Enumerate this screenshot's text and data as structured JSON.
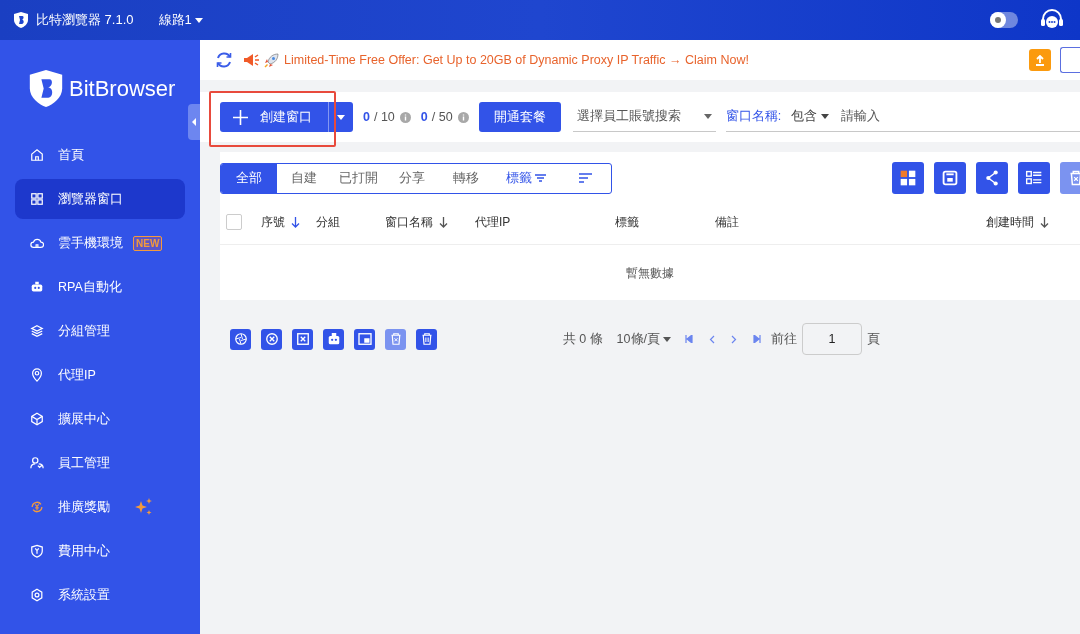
{
  "title_bar": {
    "app_title": "比特瀏覽器 7.1.0",
    "route": "線路1",
    "dark_mode": {
      "on": false
    }
  },
  "sidebar": {
    "logo_text": "BitBrowser",
    "items": [
      {
        "label": "首頁",
        "selected": false,
        "kind": "plain"
      },
      {
        "label": "瀏覽器窗口",
        "selected": true,
        "kind": "plain"
      },
      {
        "label": "雲手機環境",
        "selected": false,
        "kind": "badge",
        "badge": "NEW"
      },
      {
        "label": "RPA自動化",
        "selected": false,
        "kind": "plain"
      },
      {
        "label": "分組管理",
        "selected": false,
        "kind": "plain"
      },
      {
        "label": "代理IP",
        "selected": false,
        "kind": "plain"
      },
      {
        "label": "擴展中心",
        "selected": false,
        "kind": "plain"
      },
      {
        "label": "員工管理",
        "selected": false,
        "kind": "plain"
      },
      {
        "label": "推廣獎勵",
        "selected": false,
        "kind": "sparkle"
      },
      {
        "label": "費用中心",
        "selected": false,
        "kind": "plain"
      },
      {
        "label": "系統設置",
        "selected": false,
        "kind": "plain"
      }
    ]
  },
  "banner": {
    "text": "Limited-Time Free Offer: Get Up to 20GB of Dynamic Proxy IP Traffic → Claim Now!"
  },
  "toolbar": {
    "create_button": "創建窗口",
    "quotas": [
      {
        "used": "0",
        "limit": "/ 10"
      },
      {
        "used": "0",
        "limit": "/ 50"
      }
    ],
    "plan_button": "開通套餐",
    "employee_select": {
      "placeholder": "選擇員工賬號搜索"
    },
    "name_filter": {
      "label": "窗口名稱:",
      "mode": "包含",
      "placeholder": "請輸入"
    }
  },
  "filter_tabs": [
    {
      "label": "全部",
      "selected": true,
      "kind": "plain"
    },
    {
      "label": "自建",
      "selected": false,
      "kind": "plain"
    },
    {
      "label": "已打開",
      "selected": false,
      "kind": "plain"
    },
    {
      "label": "分享",
      "selected": false,
      "kind": "plain"
    },
    {
      "label": "轉移",
      "selected": false,
      "kind": "plain"
    },
    {
      "label": "標籤",
      "selected": false,
      "kind": "filter"
    }
  ],
  "table_actions": [
    {
      "disabled": false
    },
    {
      "disabled": false
    },
    {
      "disabled": false
    },
    {
      "disabled": false
    },
    {
      "disabled": true
    }
  ],
  "table": {
    "select_all": {
      "checked": false
    },
    "columns": [
      {
        "label": "序號",
        "sortable": true
      },
      {
        "label": "分組",
        "sortable": false
      },
      {
        "label": "窗口名稱",
        "sortable": true
      },
      {
        "label": "代理IP",
        "sortable": false
      },
      {
        "label": "標籤",
        "sortable": false
      },
      {
        "label": "備註",
        "sortable": false
      },
      {
        "label": "創建時間",
        "sortable": true
      }
    ],
    "empty_text": "暫無數據"
  },
  "bulk_actions": [
    {
      "disabled": false
    },
    {
      "disabled": false
    },
    {
      "disabled": false
    },
    {
      "disabled": false
    },
    {
      "disabled": false
    },
    {
      "disabled": true
    },
    {
      "disabled": false
    }
  ],
  "pagination": {
    "total": "共 0 條",
    "page_size": "10條/頁",
    "goto_label": "前往",
    "page": "1",
    "page_suffix": "頁"
  }
}
